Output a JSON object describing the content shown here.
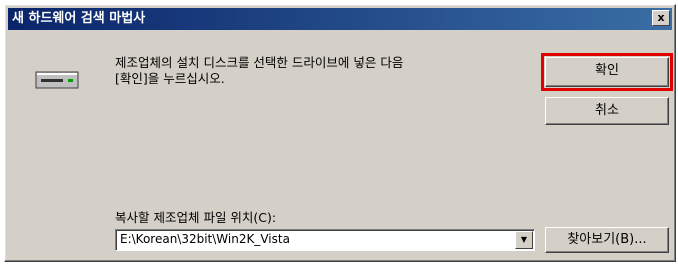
{
  "window": {
    "title": "새 하드웨어 검색 마법사",
    "close_label": "x"
  },
  "dialog": {
    "message": "제조업체의 설치 디스크를 선택한 드라이브에 넣은 다음\n[확인]을 누르십시오.",
    "ok_label": "확인",
    "cancel_label": "취소"
  },
  "copy_from": {
    "label": "복사할 제조업체 파일 위치(C):",
    "value": "E:\\Korean\\32bit\\Win2K_Vista",
    "browse_label": "찾아보기(B)..."
  },
  "icons": {
    "drive": "floppy-drive-icon",
    "dropdown": "chevron-down-icon"
  },
  "colors": {
    "title_start": "#0a246a",
    "title_end": "#3a6ea5",
    "highlight": "#e00000",
    "dialog_bg": "#d4d0c8"
  }
}
